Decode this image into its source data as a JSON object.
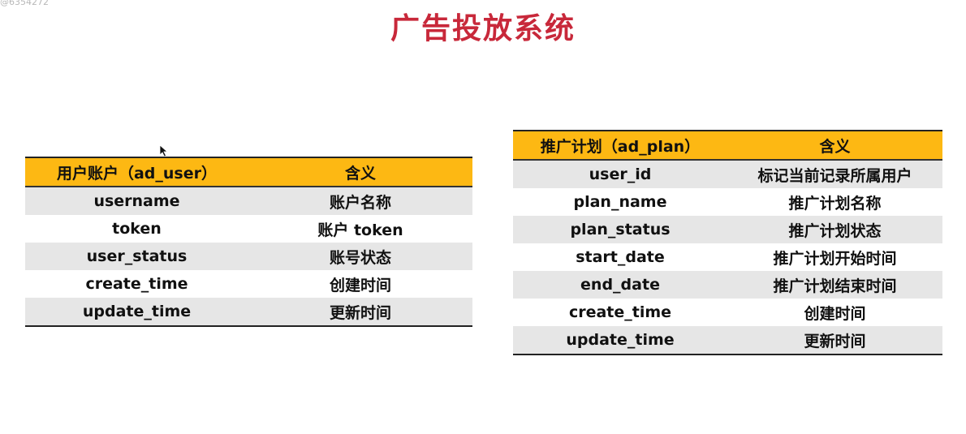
{
  "watermark": "@6354272",
  "title": "广告投放系统",
  "user_table": {
    "headers": [
      "用户账户（ad_user）",
      "含义"
    ],
    "rows": [
      [
        "username",
        "账户名称"
      ],
      [
        "token",
        "账户 token"
      ],
      [
        "user_status",
        "账号状态"
      ],
      [
        "create_time",
        "创建时间"
      ],
      [
        "update_time",
        "更新时间"
      ]
    ]
  },
  "plan_table": {
    "headers": [
      "推广计划（ad_plan）",
      "含义"
    ],
    "rows": [
      [
        "user_id",
        "标记当前记录所属用户"
      ],
      [
        "plan_name",
        "推广计划名称"
      ],
      [
        "plan_status",
        "推广计划状态"
      ],
      [
        "start_date",
        "推广计划开始时间"
      ],
      [
        "end_date",
        "推广计划结束时间"
      ],
      [
        "create_time",
        "创建时间"
      ],
      [
        "update_time",
        "更新时间"
      ]
    ]
  },
  "colors": {
    "title": "#c8283a",
    "header_bg": "#fdb813",
    "row_alt_bg": "#e6e6e6"
  }
}
